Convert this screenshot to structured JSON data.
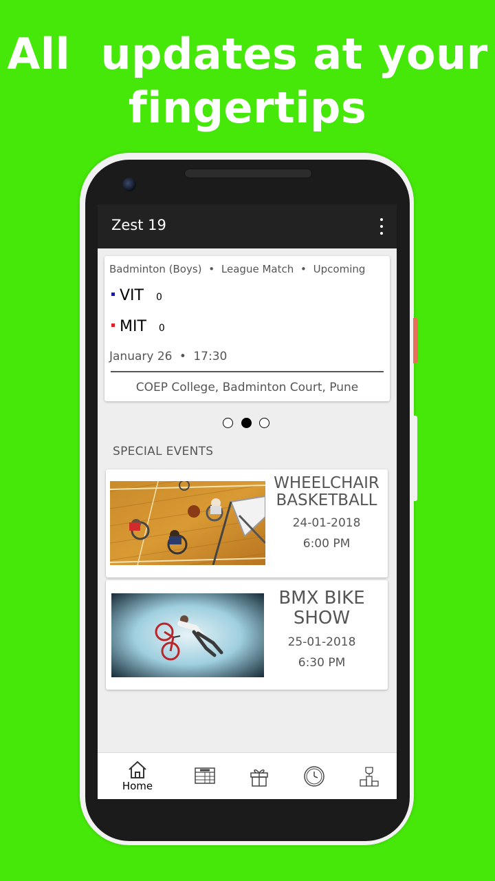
{
  "promo": {
    "line1": "All  updates at your",
    "line2": "fingertips"
  },
  "app": {
    "title": "Zest 19"
  },
  "match": {
    "sport": "Badminton (Boys)",
    "stage": "League Match",
    "status": "Upcoming",
    "team1": {
      "name": "VIT",
      "score": "0",
      "color": "#1a1aa6"
    },
    "team2": {
      "name": "MIT",
      "score": "0",
      "color": "#e02020"
    },
    "date": "January 26",
    "time": "17:30",
    "venue": "COEP College, Badminton Court, Pune"
  },
  "carousel": {
    "pages": 3,
    "active_index": 1
  },
  "special_events": {
    "title": "SPECIAL EVENTS",
    "items": [
      {
        "title_line1": "WHEELCHAIR",
        "title_line2": "BASKETBALL",
        "date": "24-01-2018",
        "time": "6:00 PM"
      },
      {
        "title_line1": "BMX BIKE",
        "title_line2": "SHOW",
        "date": "25-01-2018",
        "time": "6:30 PM"
      }
    ]
  },
  "bottom_nav": {
    "items": [
      {
        "label": "Home",
        "icon": "home-icon",
        "active": true
      },
      {
        "label": "",
        "icon": "scoreboard-icon"
      },
      {
        "label": "",
        "icon": "gift-icon"
      },
      {
        "label": "",
        "icon": "clock-icon"
      },
      {
        "label": "",
        "icon": "podium-icon"
      }
    ]
  },
  "colors": {
    "background": "#46e80a",
    "appbar": "#222222",
    "screen": "#eeeeee"
  }
}
